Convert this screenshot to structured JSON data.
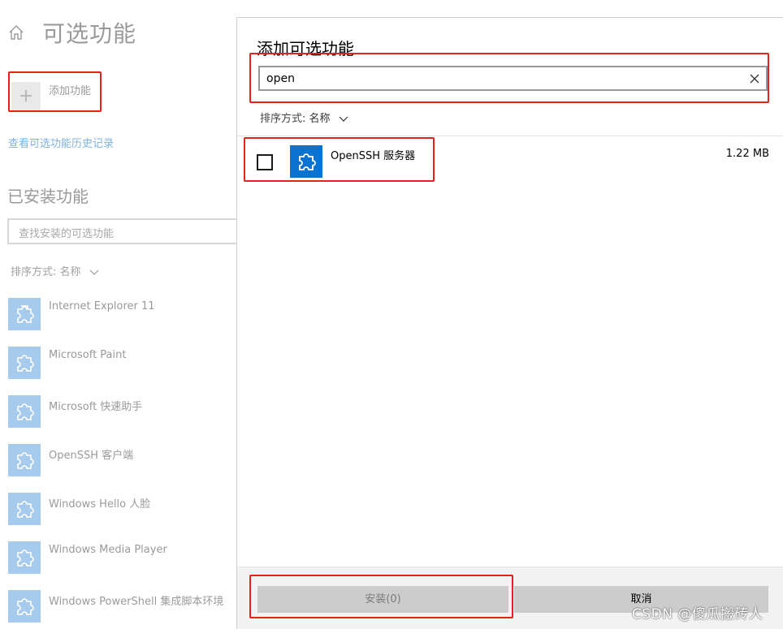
{
  "settings": {
    "title": "可选功能",
    "add_feature_label": "添加功能",
    "history_link": "查看可选功能历史记录",
    "installed_title": "已安装功能",
    "installed_search_placeholder": "查找安装的可选功能",
    "sort_label": "排序方式:",
    "sort_value": "名称",
    "installed_items": [
      {
        "label": "Internet Explorer 11"
      },
      {
        "label": "Microsoft Paint"
      },
      {
        "label": "Microsoft 快速助手"
      },
      {
        "label": "OpenSSH 客户端"
      },
      {
        "label": "Windows Hello 人脸"
      },
      {
        "label": "Windows Media Player"
      },
      {
        "label": "Windows PowerShell 集成脚本环境"
      }
    ]
  },
  "dialog": {
    "title": "添加可选功能",
    "search_value": "open",
    "sort_label": "排序方式:",
    "sort_value": "名称",
    "results": [
      {
        "name": "OpenSSH 服务器",
        "size": "1.22 MB",
        "checked": false
      }
    ],
    "install_label": "安装(0)",
    "cancel_label": "取消"
  },
  "watermark": "CSDN @傻瓜搬砖人",
  "colors": {
    "accent": "#0a73cf",
    "annotation_red": "#e8201c",
    "link": "#7fb2df",
    "dim_text": "#9a9a9a"
  },
  "icons": {
    "home": "home-icon",
    "add": "plus-icon",
    "feature": "puzzle-icon",
    "clear": "close-icon",
    "sort": "chevron-down-icon"
  }
}
